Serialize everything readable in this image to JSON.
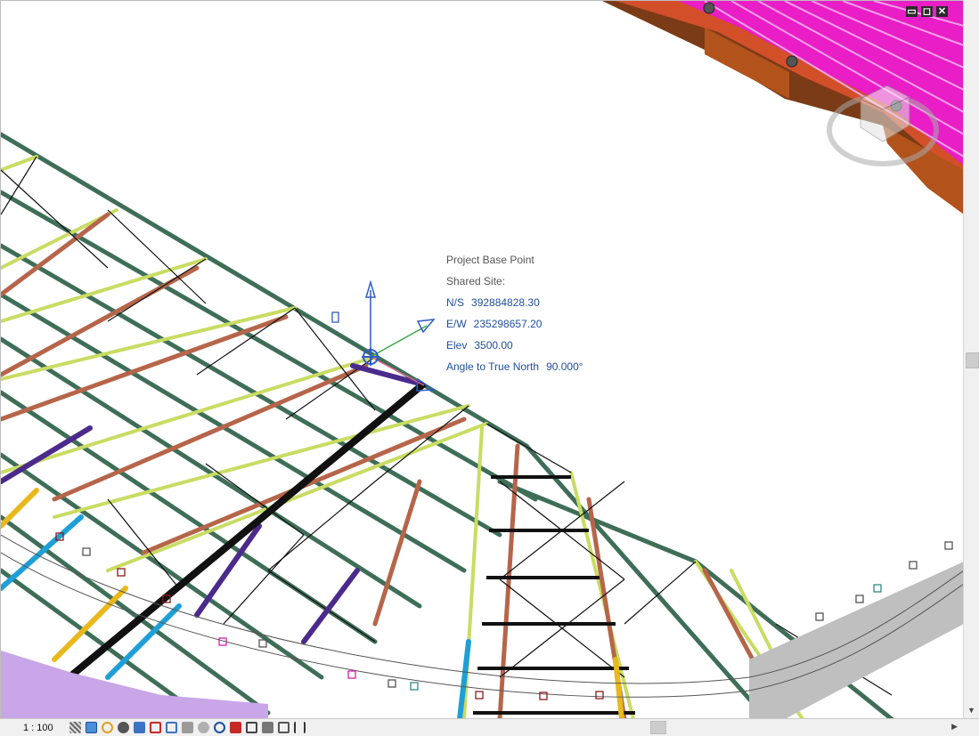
{
  "viewport": {
    "window_buttons": [
      "▭",
      "◻",
      "✕"
    ]
  },
  "base_point": {
    "title": "Project Base Point",
    "site_label": "Shared Site:",
    "ns_label": "N/S",
    "ns_value": "392884828.30",
    "ew_label": "E/W",
    "ew_value": "235298657.20",
    "elev_label": "Elev",
    "elev_value": "3500.00",
    "angle_label": "Angle to True North",
    "angle_value": "90.000°"
  },
  "statusbar": {
    "scale": "1 : 100",
    "icons": [
      "detail-level-icon",
      "visual-style-icon",
      "sun-path-icon",
      "shadows-icon",
      "render-icon",
      "crop-view-icon",
      "show-crop-icon",
      "unlock-3d-view-icon",
      "temporary-hide-icon",
      "reveal-hidden-icon",
      "temporary-view-properties-icon",
      "worksharing-display-icon",
      "analytical-model-icon",
      "highlight-displacement-icon",
      "reveal-constraints-icon"
    ]
  },
  "colors": {
    "steel_green": "#3f6e58",
    "truss_yellow": "#c9dc62",
    "rafter_brown": "#b6654a",
    "brace_purple": "#4b2a8c",
    "cyan_column": "#1ea0d6",
    "roof_magenta": "#e020b8",
    "timber_brown": "#a04a10"
  }
}
